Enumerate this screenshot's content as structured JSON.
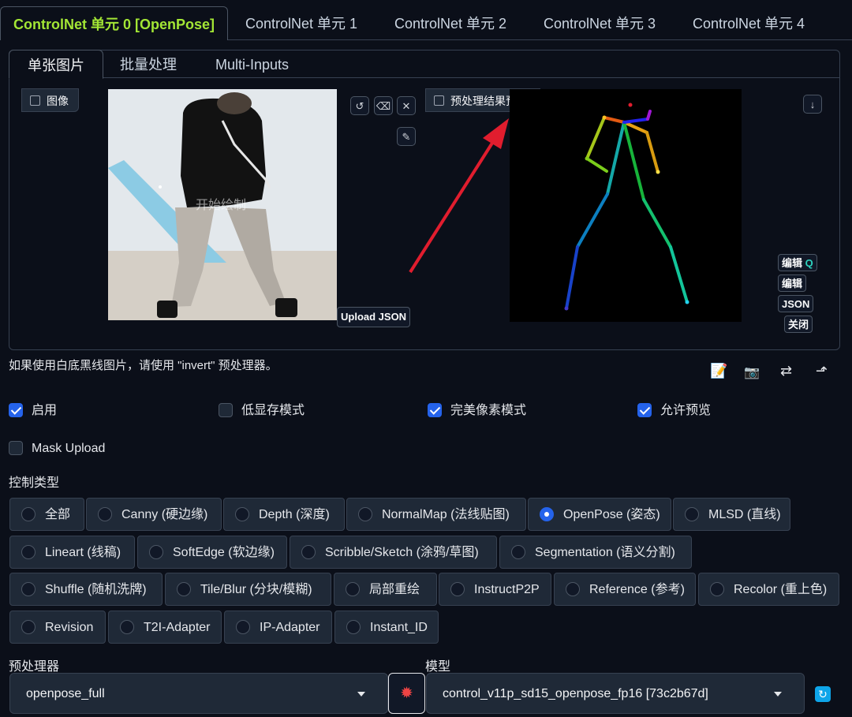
{
  "tabs": [
    "ControlNet 单元 0 [OpenPose]",
    "ControlNet 单元 1",
    "ControlNet 单元 2",
    "ControlNet 单元 3",
    "ControlNet 单元 4"
  ],
  "sub_tabs": [
    "单张图片",
    "批量处理",
    "Multi-Inputs"
  ],
  "image_panel": {
    "label": "图像",
    "overlay_text": "开始绘制",
    "upload_json": "Upload JSON"
  },
  "preview_panel": {
    "label": "预处理结果预览",
    "buttons": [
      "编辑",
      "编辑",
      "JSON",
      "关闭"
    ]
  },
  "hint": "如果使用白底黑线图片，请使用 \"invert\" 预处理器。",
  "checkboxes": [
    {
      "label": "启用",
      "checked": true
    },
    {
      "label": "低显存模式",
      "checked": false
    },
    {
      "label": "完美像素模式",
      "checked": true
    },
    {
      "label": "允许预览",
      "checked": true
    },
    {
      "label": "Mask Upload",
      "checked": false
    }
  ],
  "control_type": {
    "label": "控制类型",
    "options": [
      "全部",
      "Canny (硬边缘)",
      "Depth (深度)",
      "NormalMap (法线贴图)",
      "OpenPose (姿态)",
      "MLSD (直线)",
      "Lineart (线稿)",
      "SoftEdge (软边缘)",
      "Scribble/Sketch (涂鸦/草图)",
      "Segmentation (语义分割)",
      "Shuffle (随机洗牌)",
      "Tile/Blur (分块/模糊)",
      "局部重绘",
      "InstructP2P",
      "Reference (参考)",
      "Recolor (重上色)",
      "Revision",
      "T2I-Adapter",
      "IP-Adapter",
      "Instant_ID"
    ],
    "selected": "OpenPose (姿态)"
  },
  "preprocessor": {
    "label": "预处理器",
    "value": "openpose_full"
  },
  "model": {
    "label": "模型",
    "value": "control_v11p_sd15_openpose_fp16 [73c2b67d]"
  },
  "colors": {
    "accent_green": "#a3e635",
    "accent_blue": "#2563eb",
    "annotation_red": "#e11d2e"
  }
}
